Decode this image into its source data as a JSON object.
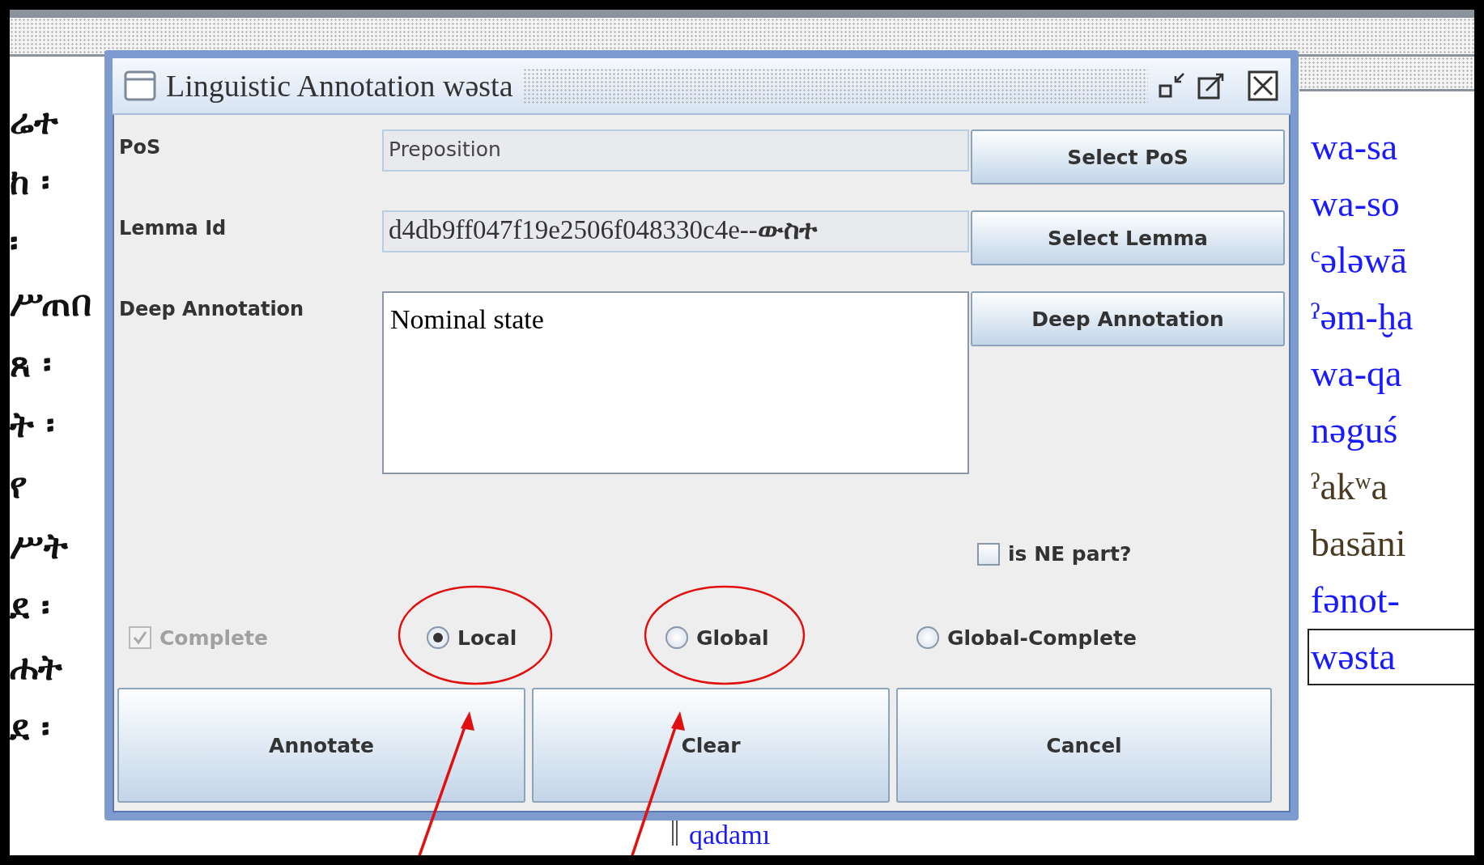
{
  "background": {
    "left_column": [
      "ሬተ",
      "ከ ፡",
      "፡",
      "ሥጠበ",
      "ጸ ፡",
      "ት ፡",
      "የ",
      "ሥት",
      "ደ ፡",
      "ሐት",
      "ደ ፡"
    ],
    "middle_word": "qadamı",
    "right_column": [
      {
        "text": "wa-sa",
        "color": "#1a1aff",
        "selected": false
      },
      {
        "text": "wa-so",
        "color": "#1a1aff",
        "selected": false
      },
      {
        "text": "ᶜələwā",
        "color": "#1a1aff",
        "selected": false
      },
      {
        "text": "ˀəm-ḫa",
        "color": "#1a1aff",
        "selected": false
      },
      {
        "text": "wa-qa",
        "color": "#1a1aff",
        "selected": false
      },
      {
        "text": "nəguś",
        "color": "#1a1aff",
        "selected": false
      },
      {
        "text": "ˀakʷa",
        "color": "#4a3a22",
        "selected": false
      },
      {
        "text": "basāni",
        "color": "#4a3a22",
        "selected": false
      },
      {
        "text": "fənot-",
        "color": "#1a1aff",
        "selected": false
      },
      {
        "text": "wəsta",
        "color": "#1a1aff",
        "selected": true
      }
    ]
  },
  "dialog": {
    "title": "Linguistic Annotation wəsta",
    "fields": [
      {
        "label": "PoS",
        "kind": "line",
        "value": "Preposition",
        "button": "Select PoS"
      },
      {
        "label": "Lemma Id",
        "kind": "serif-line",
        "value": "d4db9ff047f19e2506f048330c4e--**ውስተ**",
        "button": "Select Lemma"
      },
      {
        "label": "Deep Annotation",
        "kind": "area",
        "value": "Nominal state",
        "button": "Deep Annotation"
      }
    ],
    "ne_checkbox": {
      "label": "is NE part?",
      "checked": false,
      "disabled": false
    },
    "complete": {
      "label": "Complete",
      "checked": true,
      "disabled": true
    },
    "scope": [
      {
        "label": "Local",
        "selected": true
      },
      {
        "label": "Global",
        "selected": false
      },
      {
        "label": "Global-Complete",
        "selected": false
      }
    ],
    "buttons": [
      "Annotate",
      "Clear",
      "Cancel"
    ]
  }
}
